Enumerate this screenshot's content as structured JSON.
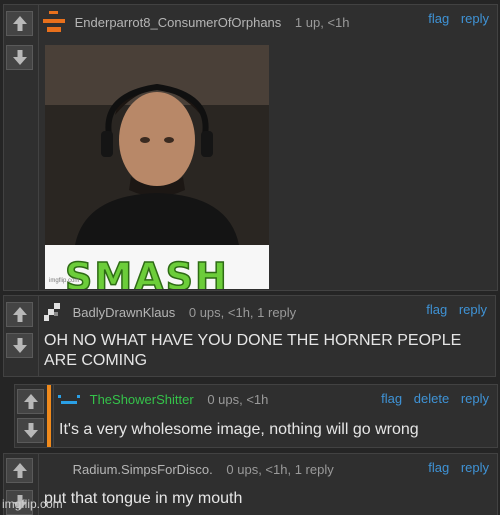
{
  "comments": [
    {
      "username": "Enderparrot8_ConsumerOfOrphans",
      "meta": "1 up, <1h",
      "actions": [
        "flag",
        "reply"
      ],
      "image_caption": "SMASH",
      "image_watermark": "imgflip.com"
    },
    {
      "username": "BadlyDrawnKlaus",
      "meta": "0 ups, <1h, 1 reply",
      "actions": [
        "flag",
        "reply"
      ],
      "text": "OH NO WHAT HAVE YOU DONE THE HORNER PEOPLE ARE COMING"
    },
    {
      "username": "TheShowerShitter",
      "meta": "0 ups, <1h",
      "actions": [
        "flag",
        "delete",
        "reply"
      ],
      "text": "It's a very wholesome image, nothing will go wrong"
    },
    {
      "username": "Radium.SimpsForDisco.",
      "meta": "0 ups, <1h, 1 reply",
      "actions": [
        "flag",
        "reply"
      ],
      "text": "put that tongue in my mouth"
    }
  ],
  "watermark": "imgflip.com",
  "colors": {
    "background": "#252525",
    "panel": "#2f2f2f",
    "link": "#3f93d6",
    "username_highlight": "#35c24a",
    "reply_accent": "#f08a1c"
  },
  "icons": {
    "upvote": "up-arrow-icon",
    "downvote": "down-arrow-icon"
  }
}
